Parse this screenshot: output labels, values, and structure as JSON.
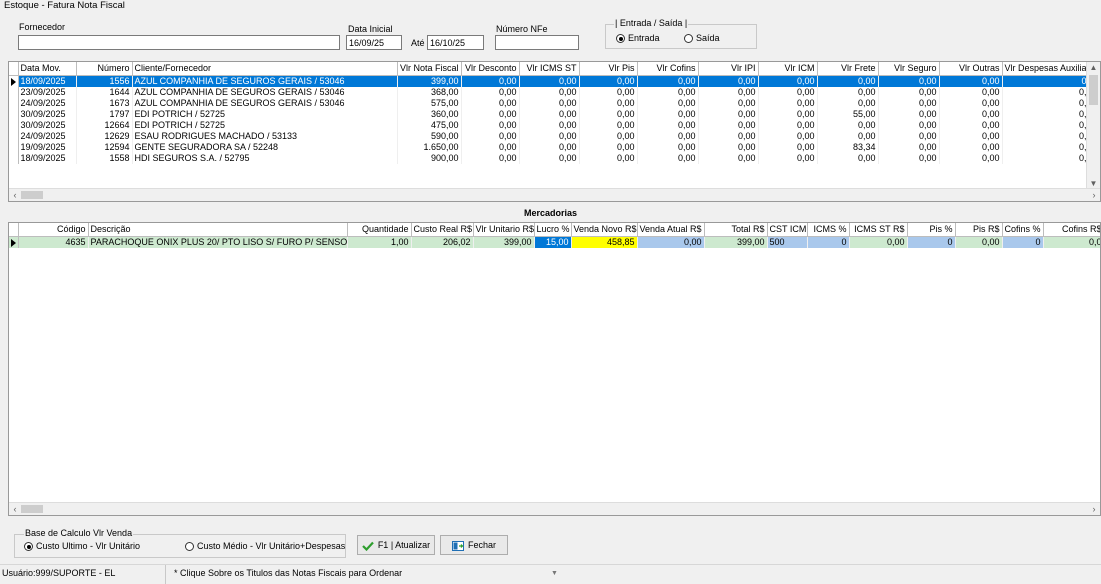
{
  "window": {
    "title": "Estoque - Fatura Nota Fiscal"
  },
  "filters": {
    "fornecedor_label": "Fornecedor",
    "fornecedor_value": "",
    "data_inicial_label": "Data Inicial",
    "data_inicial_value": "16/09/25",
    "ate_label": "Até",
    "ate_value": "16/10/25",
    "numero_nfe_label": "Número NFe",
    "numero_nfe_value": "",
    "entrada_saida_title": "| Entrada / Saída |",
    "entrada_label": "Entrada",
    "saida_label": "Saída",
    "selected": "Entrada"
  },
  "notas": {
    "columns": [
      "Data Mov.",
      "Número",
      "Cliente/Fornecedor",
      "Vlr Nota Fiscal",
      "Vlr Desconto",
      "Vlr ICMS ST",
      "Vlr Pis",
      "Vlr Cofins",
      "Vlr IPI",
      "Vlr ICM",
      "Vlr Frete",
      "Vlr Seguro",
      "Vlr Outras",
      "Vlr Despesas Auxilia"
    ],
    "rows": [
      [
        "18/09/2025",
        "1556",
        "AZUL COMPANHIA DE SEGUROS GERAIS / 53046",
        "399,00",
        "0,00",
        "0,00",
        "0,00",
        "0,00",
        "0,00",
        "0,00",
        "0,00",
        "0,00",
        "0,00",
        "0"
      ],
      [
        "23/09/2025",
        "1644",
        "AZUL COMPANHIA DE SEGUROS GERAIS / 53046",
        "368,00",
        "0,00",
        "0,00",
        "0,00",
        "0,00",
        "0,00",
        "0,00",
        "0,00",
        "0,00",
        "0,00",
        "0,"
      ],
      [
        "24/09/2025",
        "1673",
        "AZUL COMPANHIA DE SEGUROS GERAIS / 53046",
        "575,00",
        "0,00",
        "0,00",
        "0,00",
        "0,00",
        "0,00",
        "0,00",
        "0,00",
        "0,00",
        "0,00",
        "0,"
      ],
      [
        "30/09/2025",
        "1797",
        "EDI POTRICH  / 52725",
        "360,00",
        "0,00",
        "0,00",
        "0,00",
        "0,00",
        "0,00",
        "0,00",
        "55,00",
        "0,00",
        "0,00",
        "0,"
      ],
      [
        "30/09/2025",
        "12664",
        "EDI POTRICH  / 52725",
        "475,00",
        "0,00",
        "0,00",
        "0,00",
        "0,00",
        "0,00",
        "0,00",
        "0,00",
        "0,00",
        "0,00",
        "0,"
      ],
      [
        "24/09/2025",
        "12629",
        "ESAU RODRIGUES MACHADO / 53133",
        "590,00",
        "0,00",
        "0,00",
        "0,00",
        "0,00",
        "0,00",
        "0,00",
        "0,00",
        "0,00",
        "0,00",
        "0,"
      ],
      [
        "19/09/2025",
        "12594",
        "GENTE SEGURADORA SA / 52248",
        "1.650,00",
        "0,00",
        "0,00",
        "0,00",
        "0,00",
        "0,00",
        "0,00",
        "83,34",
        "0,00",
        "0,00",
        "0,"
      ],
      [
        "18/09/2025",
        "1558",
        "HDI SEGUROS S.A. / 52795",
        "900,00",
        "0,00",
        "0,00",
        "0,00",
        "0,00",
        "0,00",
        "0,00",
        "0,00",
        "0,00",
        "0,00",
        "0,"
      ]
    ]
  },
  "mercadorias": {
    "title": "Mercadorias",
    "columns": [
      "Código",
      "Descrição",
      "Quantidade",
      "Custo Real R$",
      "Vlr Unitario R$",
      "Lucro %",
      "Venda Novo R$",
      "Venda Atual R$",
      "Total R$",
      "CST ICM",
      "ICMS %",
      "ICMS ST R$",
      "Pis %",
      "Pis R$",
      "Cofins %",
      "Cofins R$"
    ],
    "rows": [
      [
        "4635",
        "PARACHOQUE ONIX PLUS 20/ PTO LISO S/ FURO P/ SENSOR",
        "1,00",
        "206,02",
        "399,00",
        "15,00",
        "458,85",
        "0,00",
        "399,00",
        "500",
        "0",
        "0,00",
        "0",
        "0,00",
        "0",
        "0,0"
      ]
    ]
  },
  "base_calculo": {
    "title": "Base de Calculo Vlr Venda",
    "option1": "Custo Ultimo - Vlr Unitário",
    "option2": "Custo Médio - Vlr Unitário+Despesas",
    "selected": "option1"
  },
  "buttons": {
    "atualizar": "F1 | Atualizar",
    "fechar": "Fechar"
  },
  "status": {
    "user": "Usuário:999/SUPORTE - EL",
    "hint": "* Clique Sobre os Titulos das Notas Fiscais para Ordenar"
  }
}
